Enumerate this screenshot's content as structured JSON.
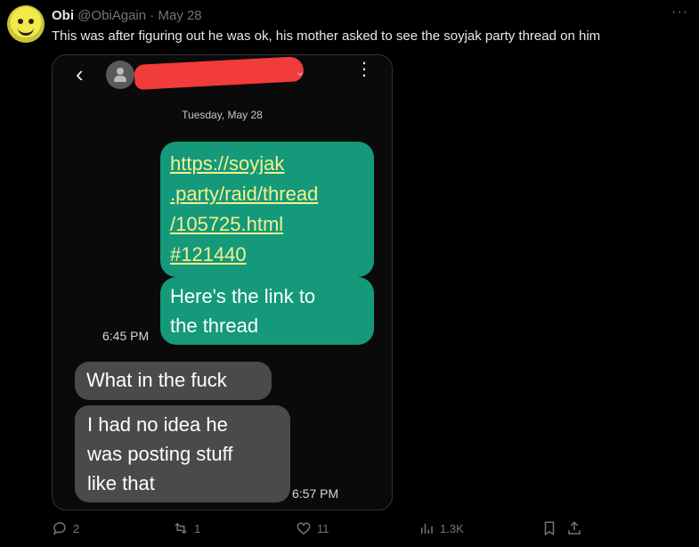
{
  "author": {
    "name": "Obi",
    "handle": "@ObiAgain",
    "separator": "·",
    "date": "May 28"
  },
  "more_label": "···",
  "post_text": "This was after figuring out he was ok, his mother asked to see the soyjak party thread on him",
  "screenshot": {
    "date_divider": "Tuesday, May 28",
    "outgoing": {
      "link_lines": [
        "https://soyjak",
        ".party/raid/thread",
        "/105725.html",
        "#121440"
      ],
      "reply_lines": [
        "Here's the link to",
        "the thread"
      ],
      "time": "6:45 PM"
    },
    "incoming": {
      "first_message": "What in the fuck",
      "second_lines": [
        "I had no idea he",
        "was posting stuff",
        "like that"
      ],
      "time": "6:57 PM"
    }
  },
  "actions": {
    "replies": "2",
    "reposts": "1",
    "likes": "11",
    "views": "1.3K"
  },
  "colors": {
    "outgoing_bubble": "#14997a",
    "incoming_bubble": "#4a4a4a",
    "link_text": "#f6f08d",
    "redaction": "#f23b3b"
  }
}
